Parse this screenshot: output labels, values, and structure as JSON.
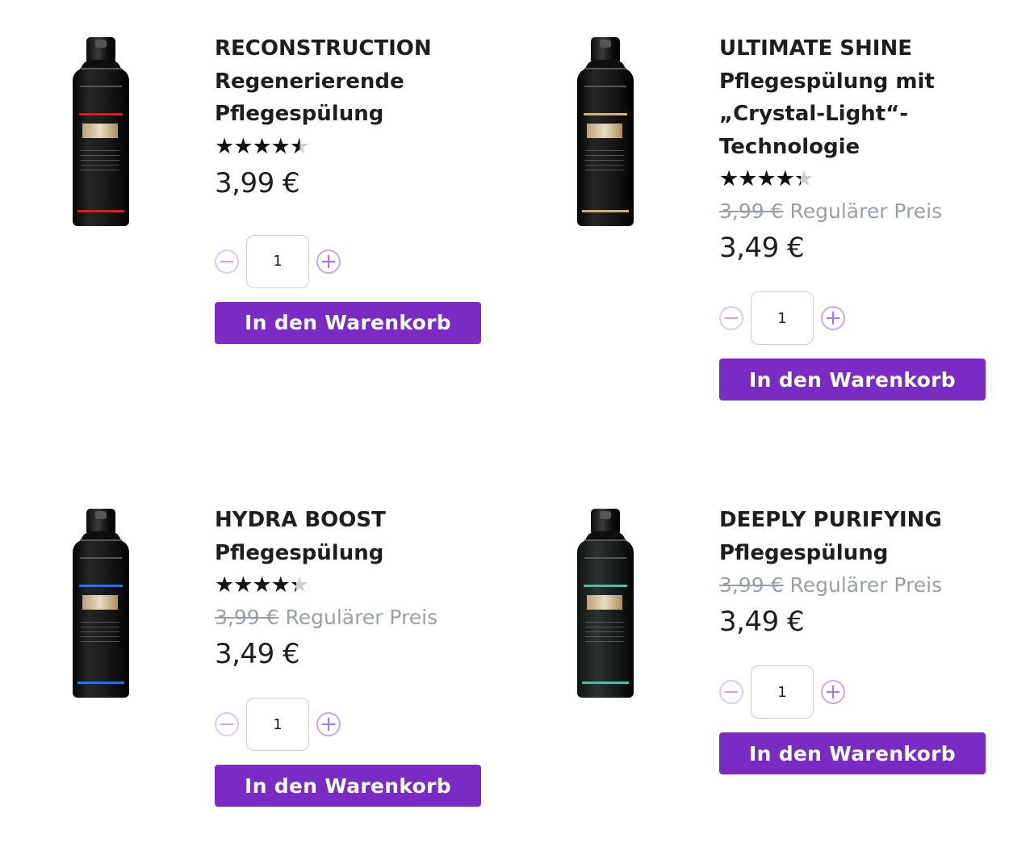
{
  "colors": {
    "accent": "#7a2bc4",
    "text": "#1e1e1e",
    "muted": "#9aa0a6"
  },
  "products": [
    {
      "title_lines": [
        "RECONSTRUCTION",
        "Regenerierende",
        "Pflegespülung"
      ],
      "rating": 4.5,
      "stars": [
        "★",
        "★",
        "★",
        "★",
        "★"
      ],
      "old_price": "",
      "regular_label": "",
      "price": "3,99 €",
      "quantity": "1",
      "minus_symbol": "−",
      "plus_symbol": "+",
      "cart_label": "In den Warenkorb",
      "bottle_accent": "#c0282d"
    },
    {
      "title_lines": [
        "ULTIMATE SHINE",
        "Pflegespülung mit",
        "„Crystal-Light“-",
        "Technologie"
      ],
      "rating": 4.3,
      "stars": [
        "★",
        "★",
        "★",
        "★",
        "★"
      ],
      "old_price": "3,99 €",
      "regular_label": "Regulärer Preis",
      "price": "3,49 €",
      "quantity": "1",
      "minus_symbol": "−",
      "plus_symbol": "+",
      "cart_label": "In den Warenkorb",
      "bottle_accent": "#c7b27a"
    },
    {
      "title_lines": [
        "HYDRA BOOST",
        "Pflegespülung"
      ],
      "rating": 4.3,
      "stars": [
        "★",
        "★",
        "★",
        "★",
        "★"
      ],
      "old_price": "3,99 €",
      "regular_label": "Regulärer Preis",
      "price": "3,49 €",
      "quantity": "1",
      "minus_symbol": "−",
      "plus_symbol": "+",
      "cart_label": "In den Warenkorb",
      "bottle_accent": "#2d6fd6"
    },
    {
      "title_lines": [
        "DEEPLY PURIFYING",
        "Pflegespülung"
      ],
      "rating": null,
      "stars": [],
      "old_price": "3,99 €",
      "regular_label": "Regulärer Preis",
      "price": "3,49 €",
      "quantity": "1",
      "minus_symbol": "−",
      "plus_symbol": "+",
      "cart_label": "In den Warenkorb",
      "bottle_accent": "#5fb3a3"
    }
  ]
}
